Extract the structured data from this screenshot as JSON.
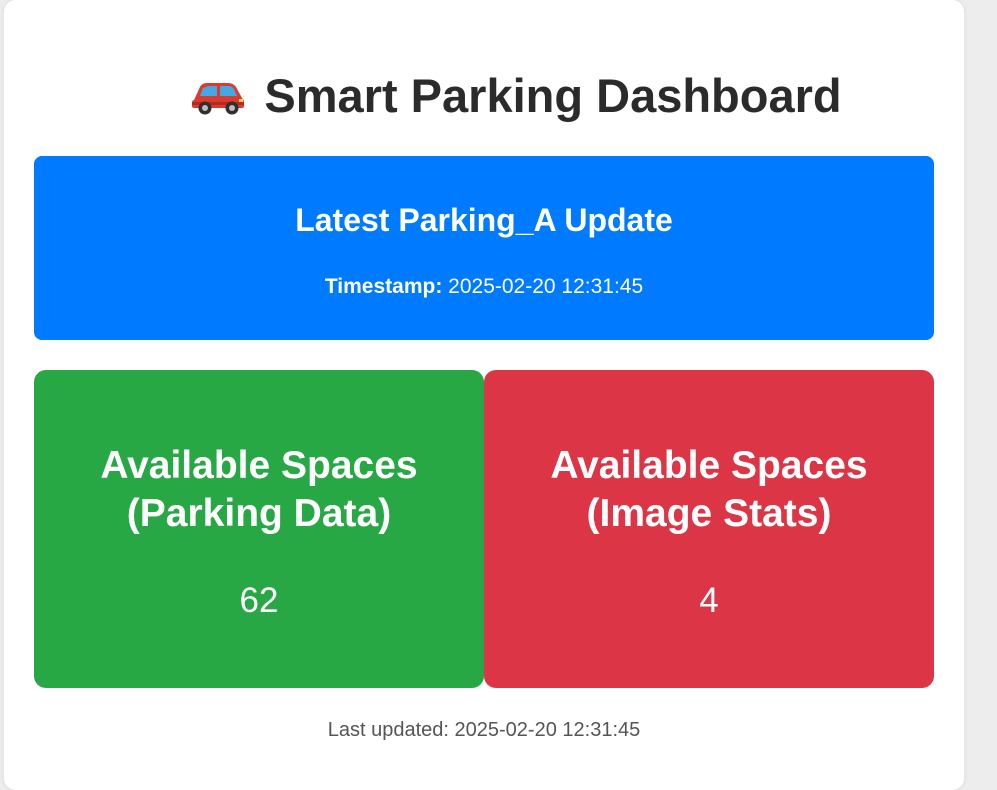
{
  "header": {
    "title": "Smart Parking Dashboard",
    "icon": "car-icon"
  },
  "latest": {
    "heading": "Latest Parking_A Update",
    "timestamp_label": "Timestamp:",
    "timestamp_value": "2025-02-20 12:31:45",
    "color": "#007bff"
  },
  "stats": [
    {
      "title_line1": "Available Spaces",
      "title_line2": "(Parking Data)",
      "value": "62",
      "color": "#28a745"
    },
    {
      "title_line1": "Available Spaces",
      "title_line2": "(Image Stats)",
      "value": "4",
      "color": "#dc3545"
    }
  ],
  "footer": {
    "label": "Last updated:",
    "timestamp": "2025-02-20 12:31:45"
  }
}
